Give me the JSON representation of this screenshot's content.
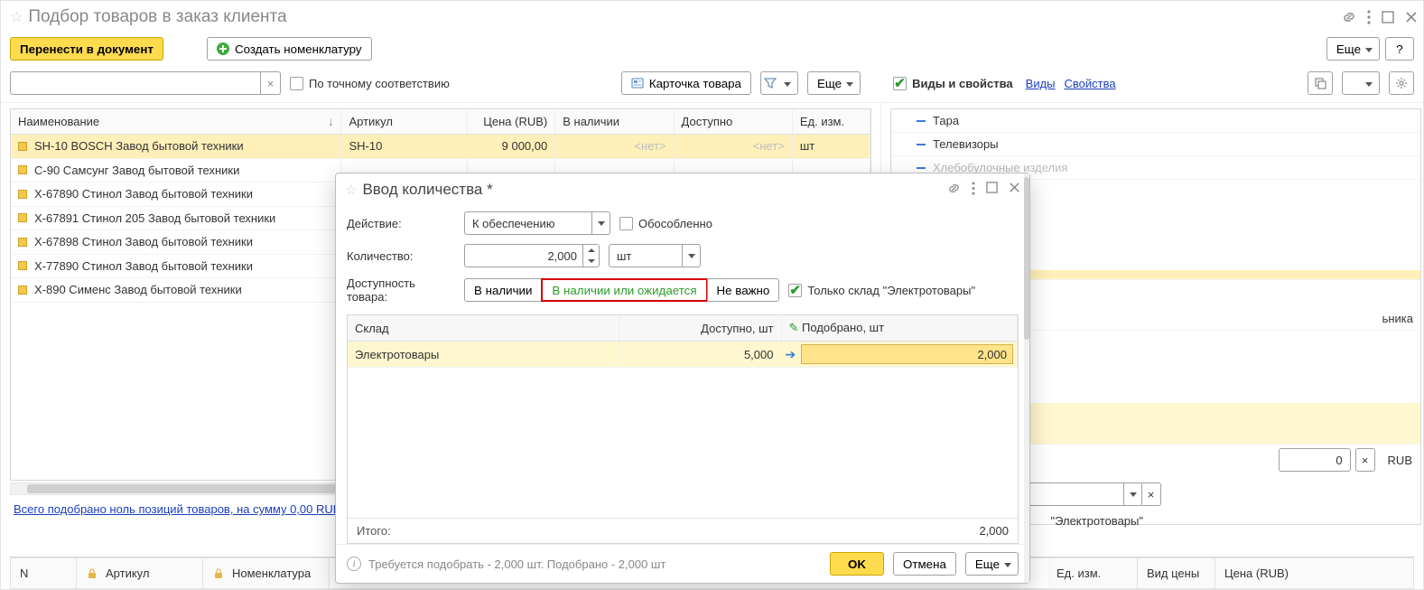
{
  "window": {
    "title": "Подбор товаров в заказ клиента",
    "more": "Еще",
    "help": "?"
  },
  "toolbar": {
    "transfer": "Перенести в документ",
    "create_nom": "Создать номенклатуру"
  },
  "filterbar": {
    "exact_match": "По точному соответствию",
    "card": "Карточка товара",
    "more": "Еще"
  },
  "rightheader": {
    "label": "Виды и свойства",
    "link1": "Виды",
    "link2": "Свойства"
  },
  "table": {
    "cols": {
      "name": "Наименование",
      "sku": "Артикул",
      "price": "Цена (RUB)",
      "stock": "В наличии",
      "avail": "Доступно",
      "unit": "Ед. изм."
    },
    "rows": [
      {
        "name": "SH-10 BOSCH Завод бытовой техники",
        "sku": "SH-10",
        "price": "9 000,00",
        "stock": "<нет>",
        "avail": "<нет>",
        "unit": "шт",
        "sel": true
      },
      {
        "name": "С-90 Самсунг Завод бытовой техники"
      },
      {
        "name": "Х-67890 Стинол Завод бытовой техники"
      },
      {
        "name": "Х-67891 Стинол 205 Завод бытовой техники"
      },
      {
        "name": "Х-67898 Стинол Завод бытовой техники"
      },
      {
        "name": "Х-77890 Стинол Завод бытовой техники"
      },
      {
        "name": "Х-890 Сименс Завод бытовой техники"
      }
    ]
  },
  "tree": {
    "items": [
      "Тара",
      "Телевизоры",
      "Хлебобулочные изделия"
    ],
    "peek": "ьника"
  },
  "summary_link": "Всего подобрано ноль позиций товаров, на сумму 0,00 RUB",
  "picked_cols": [
    "N",
    "Артикул",
    "Номенклатура",
    "Ед. изм.",
    "Вид цены",
    "Цена (RUB)"
  ],
  "right_stub": {
    "zero": "0",
    "currency": "RUB",
    "warehouse": "\"Электротовары\""
  },
  "dialog": {
    "title": "Ввод количества *",
    "labels": {
      "action": "Действие:",
      "qty": "Количество:",
      "avail": "Доступность товара:"
    },
    "action_value": "К обеспечению",
    "isolated": "Обособленно",
    "qty_value": "2,000",
    "unit": "шт",
    "seg": {
      "a": "В наличии",
      "b": "В наличии или ожидается",
      "c": "Не важно"
    },
    "only_wh": "Только склад \"Электротовары\"",
    "dcols": {
      "wh": "Склад",
      "avail": "Доступно, шт",
      "picked": "Подобрано, шт"
    },
    "drow": {
      "wh": "Электротовары",
      "avail": "5,000",
      "picked": "2,000"
    },
    "total_label": "Итого:",
    "total_value": "2,000",
    "hint": "Требуется подобрать - 2,000 шт. Подобрано - 2,000 шт",
    "ok": "OK",
    "cancel": "Отмена",
    "more": "Еще"
  }
}
